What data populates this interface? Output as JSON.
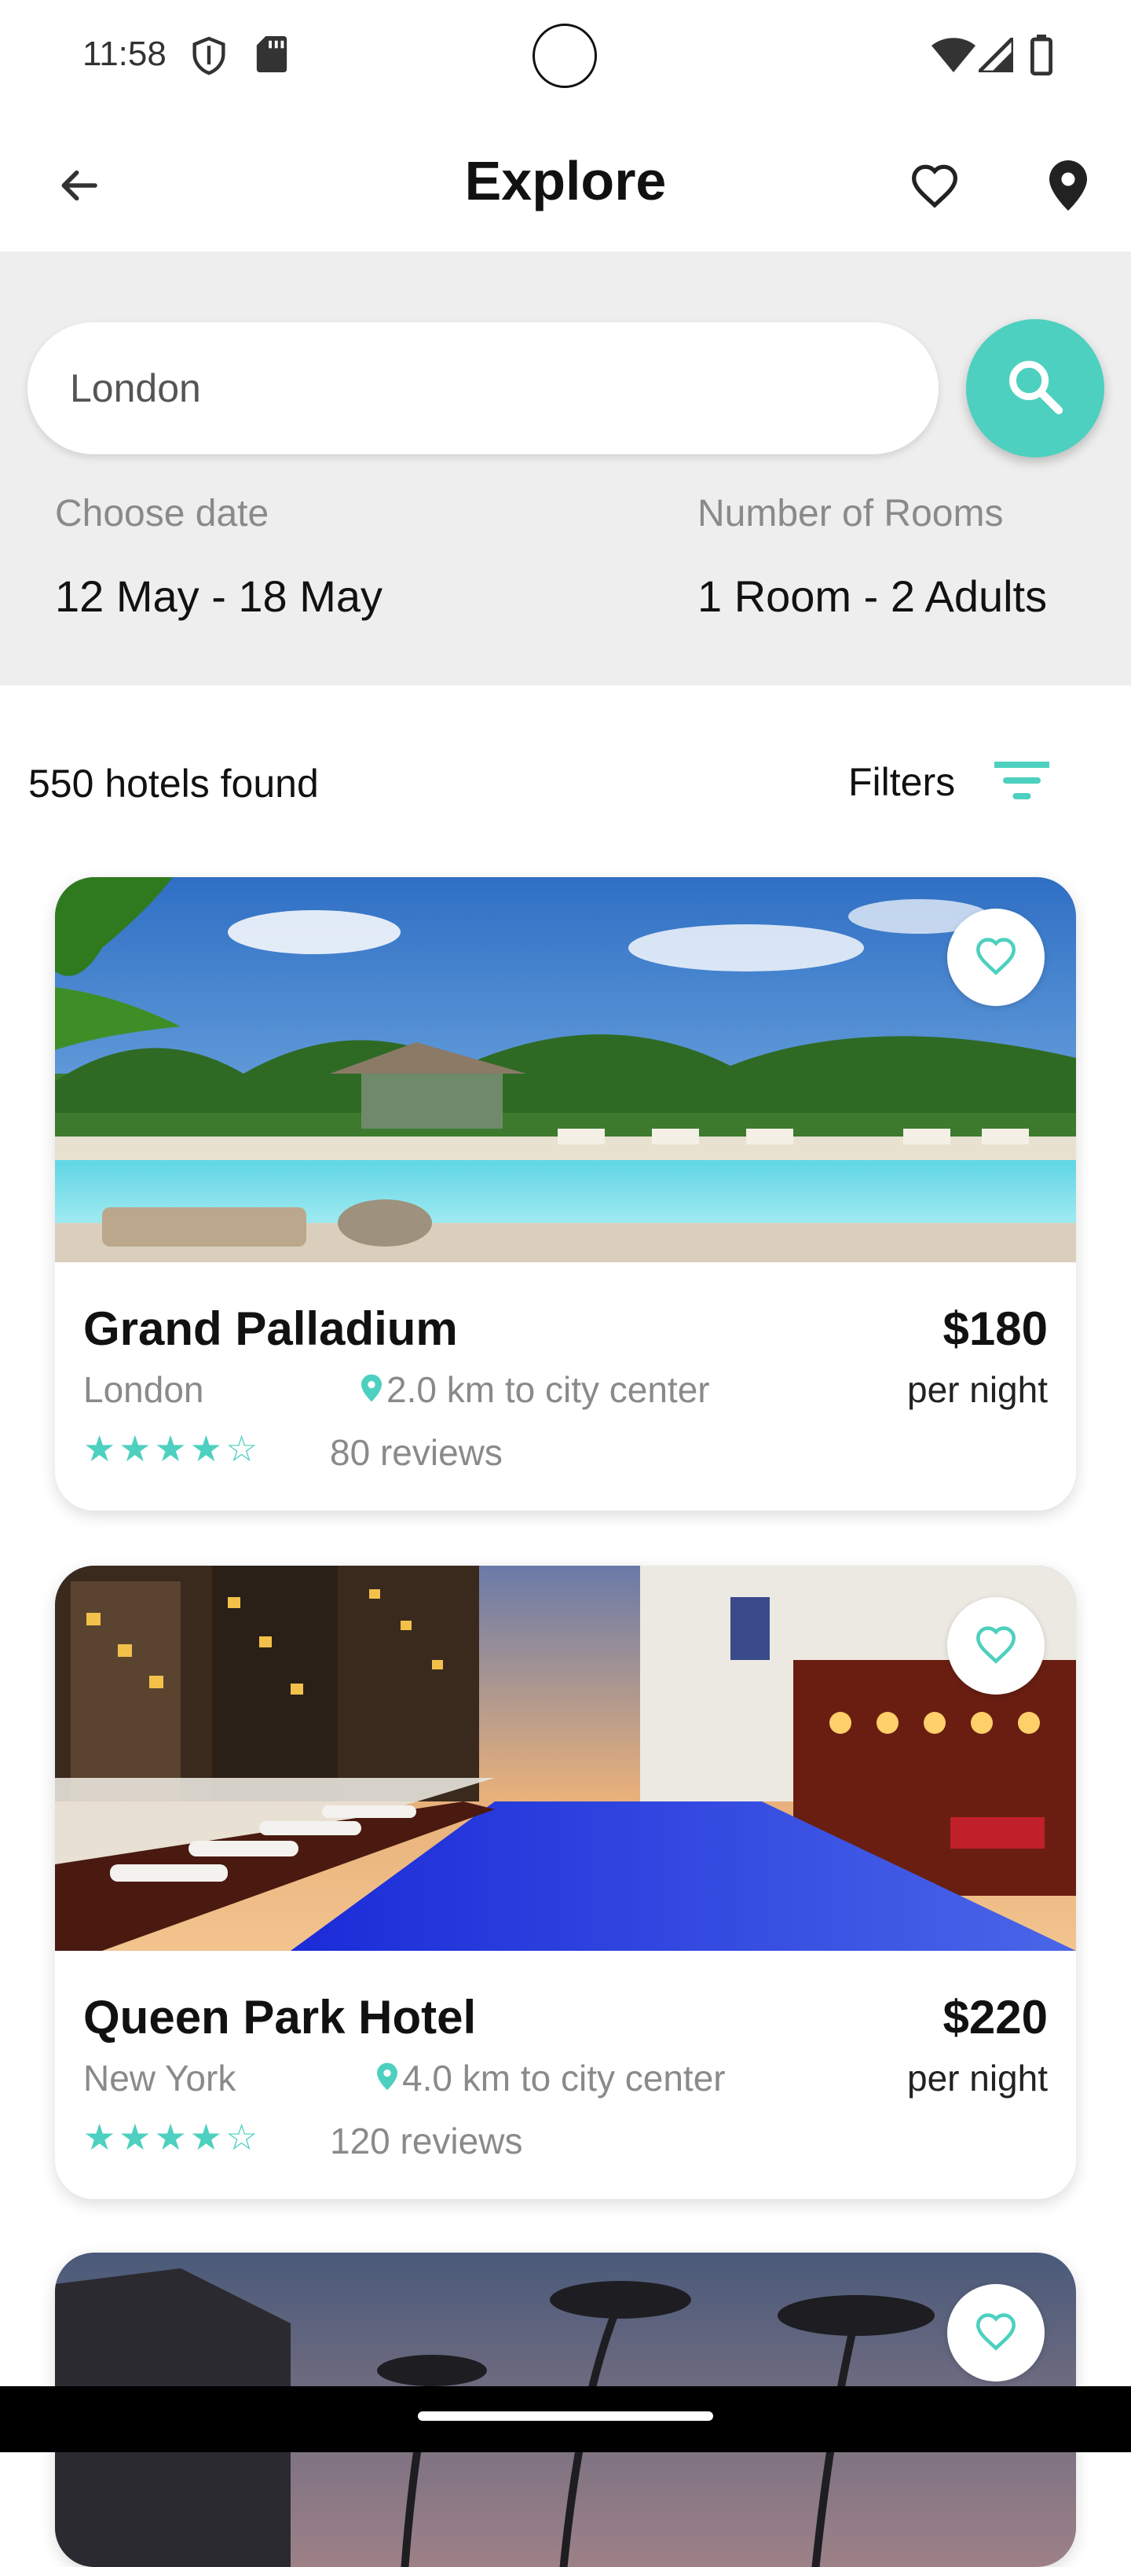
{
  "status_bar": {
    "time": "11:58"
  },
  "app_bar": {
    "title": "Explore"
  },
  "search": {
    "value": "London",
    "date_label": "Choose date",
    "date_value": "12 May - 18 May",
    "rooms_label": "Number of Rooms",
    "rooms_value": "1 Room - 2 Adults"
  },
  "results": {
    "count_text": "550 hotels found",
    "filters_label": "Filters"
  },
  "hotels": [
    {
      "name": "Grand Palladium",
      "city": "London",
      "distance": "2.0 km to city center",
      "price": "$180",
      "per_night": "per night",
      "stars": "★★★★☆",
      "reviews": "80 reviews"
    },
    {
      "name": "Queen Park Hotel",
      "city": "New York",
      "distance": "4.0 km to city center",
      "price": "$220",
      "per_night": "per night",
      "stars": "★★★★☆",
      "reviews": "120 reviews"
    },
    {}
  ],
  "colors": {
    "accent": "#4dd0bf",
    "panel_bg": "#eeeeee"
  },
  "icons": [
    "back-arrow-icon",
    "heart-outline-icon",
    "location-pin-icon",
    "search-icon",
    "filter-icon",
    "shield-icon",
    "sd-card-icon",
    "wifi-icon",
    "signal-icon",
    "battery-icon"
  ]
}
